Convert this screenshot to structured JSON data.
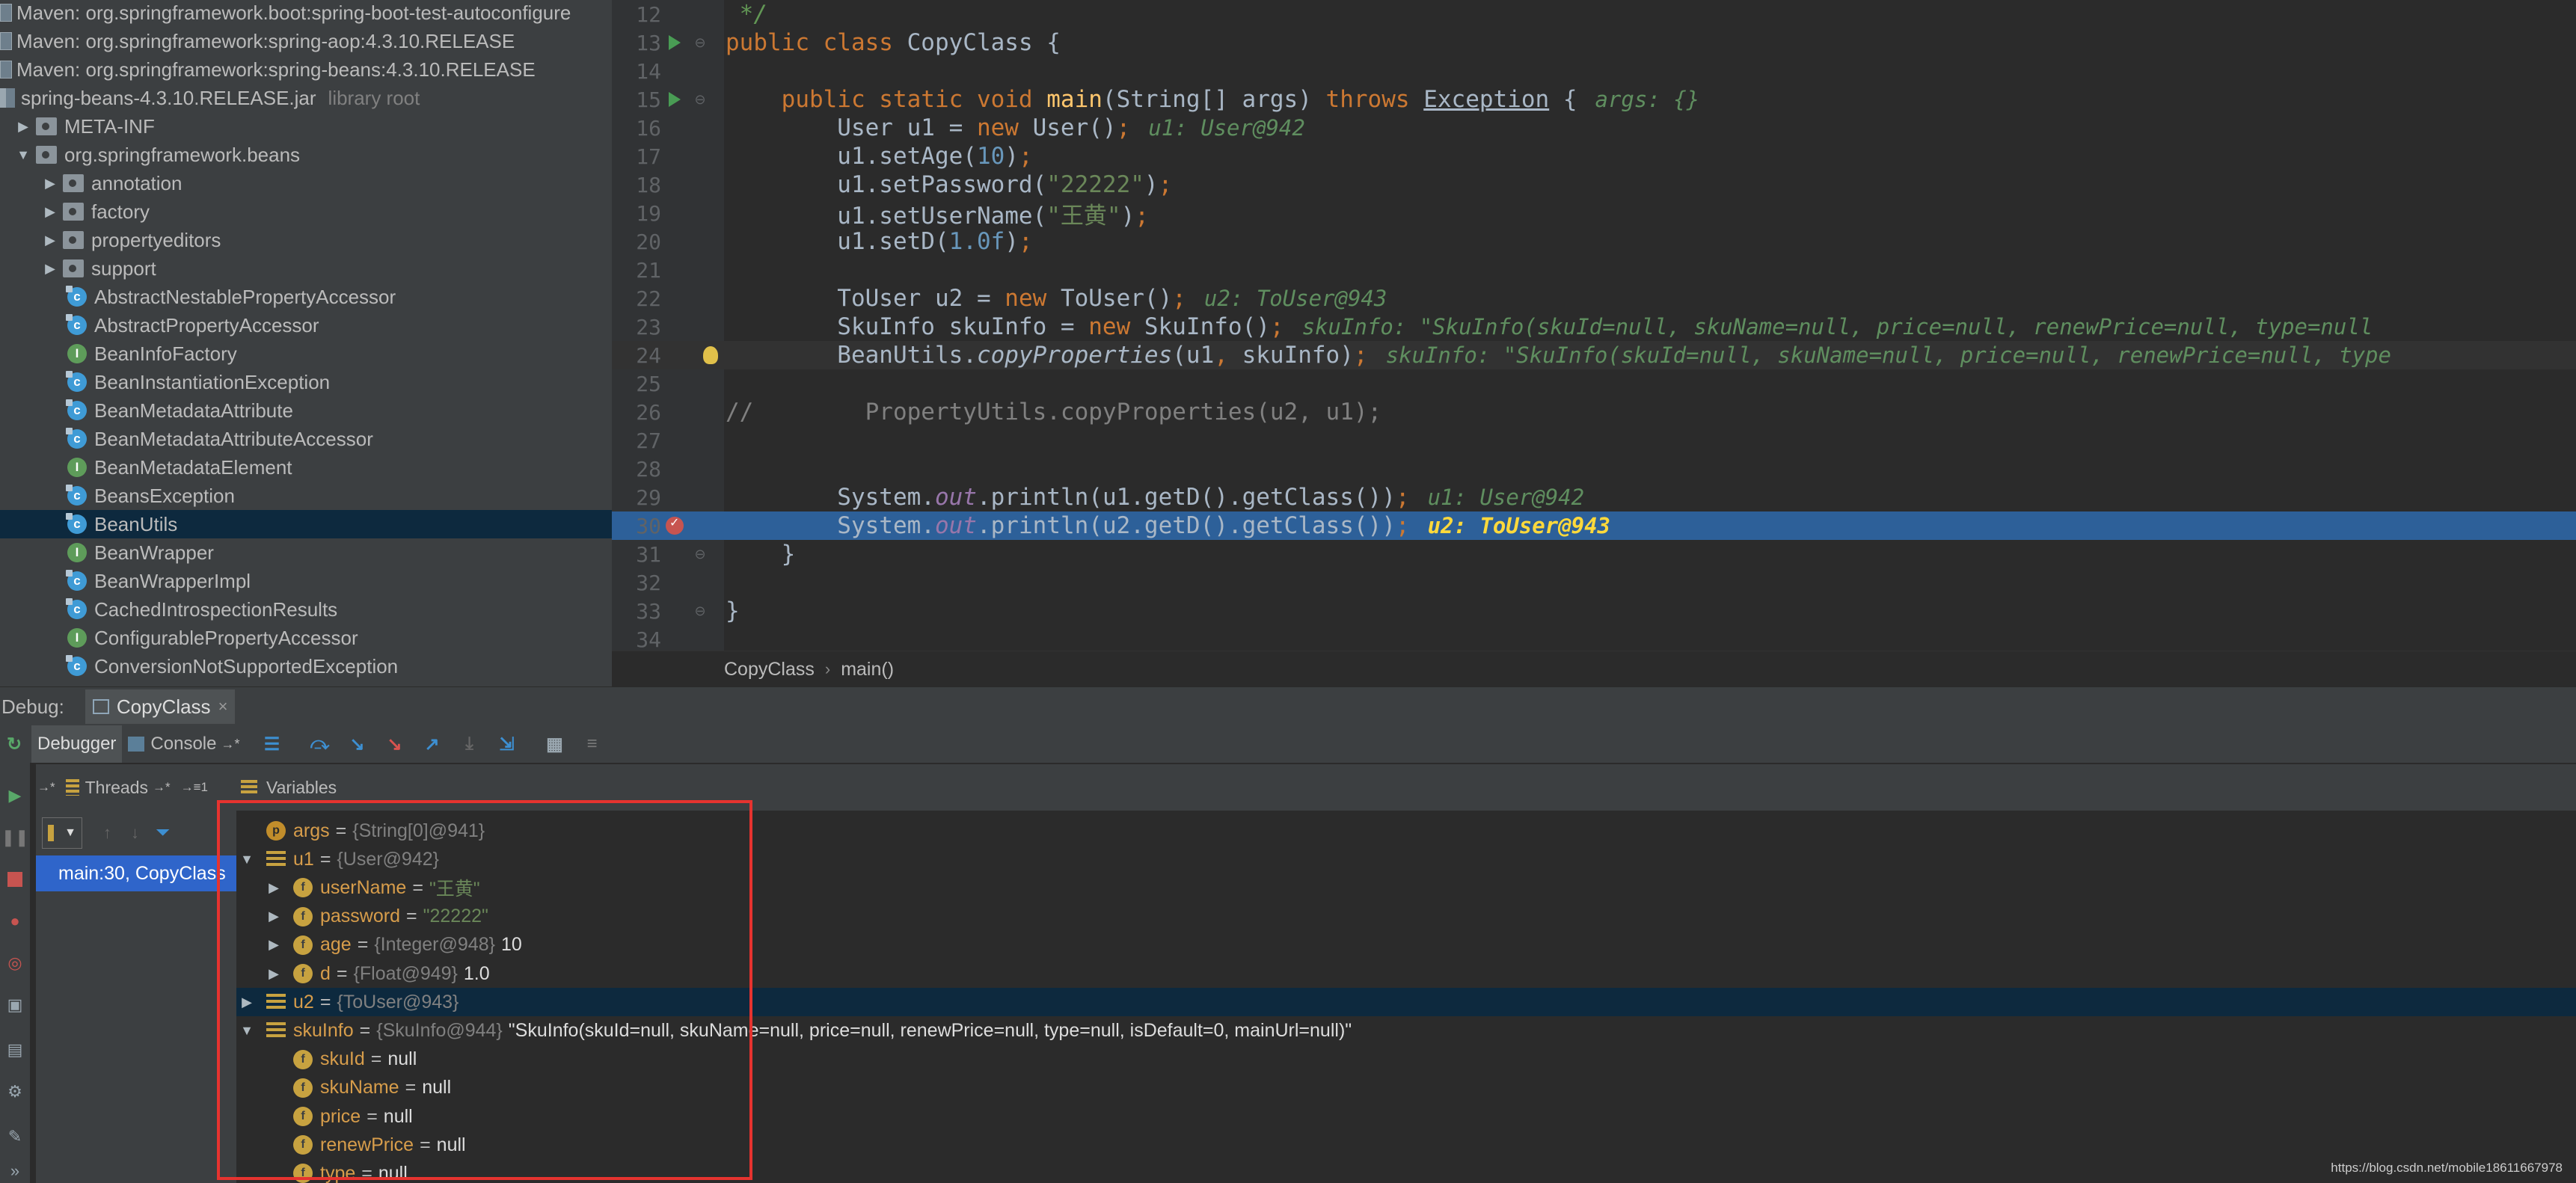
{
  "project_tree": {
    "rows": [
      {
        "icon": "maven-library-icon",
        "label": "Maven: org.springframework.boot:spring-boot-test-autoconfigure",
        "indent": 0,
        "toggle": "",
        "extra": ""
      },
      {
        "icon": "maven-library-icon",
        "label": "Maven: org.springframework:spring-aop:4.3.10.RELEASE",
        "indent": 0,
        "toggle": "",
        "extra": ""
      },
      {
        "icon": "maven-library-icon",
        "label": "Maven: org.springframework:spring-beans:4.3.10.RELEASE",
        "indent": 0,
        "toggle": "",
        "extra": ""
      },
      {
        "icon": "jar-icon",
        "label": "spring-beans-4.3.10.RELEASE.jar",
        "indent": 0,
        "toggle": "",
        "extra": "library root"
      },
      {
        "icon": "folder-icon",
        "label": "META-INF",
        "indent": 1,
        "toggle": "▶",
        "extra": ""
      },
      {
        "icon": "package-icon",
        "label": "org.springframework.beans",
        "indent": 1,
        "toggle": "▼",
        "extra": ""
      },
      {
        "icon": "package-icon",
        "label": "annotation",
        "indent": 2,
        "toggle": "▶",
        "extra": ""
      },
      {
        "icon": "package-icon",
        "label": "factory",
        "indent": 2,
        "toggle": "▶",
        "extra": ""
      },
      {
        "icon": "package-icon",
        "label": "propertyeditors",
        "indent": 2,
        "toggle": "▶",
        "extra": ""
      },
      {
        "icon": "package-icon",
        "label": "support",
        "indent": 2,
        "toggle": "▶",
        "extra": ""
      },
      {
        "icon": "class-icon",
        "label": "AbstractNestablePropertyAccessor",
        "indent": 3,
        "toggle": "",
        "extra": ""
      },
      {
        "icon": "class-icon",
        "label": "AbstractPropertyAccessor",
        "indent": 3,
        "toggle": "",
        "extra": ""
      },
      {
        "icon": "interface-icon",
        "label": "BeanInfoFactory",
        "indent": 3,
        "toggle": "",
        "extra": ""
      },
      {
        "icon": "class-icon",
        "label": "BeanInstantiationException",
        "indent": 3,
        "toggle": "",
        "extra": ""
      },
      {
        "icon": "class-icon",
        "label": "BeanMetadataAttribute",
        "indent": 3,
        "toggle": "",
        "extra": ""
      },
      {
        "icon": "class-icon",
        "label": "BeanMetadataAttributeAccessor",
        "indent": 3,
        "toggle": "",
        "extra": ""
      },
      {
        "icon": "interface-icon",
        "label": "BeanMetadataElement",
        "indent": 3,
        "toggle": "",
        "extra": ""
      },
      {
        "icon": "class-icon",
        "label": "BeansException",
        "indent": 3,
        "toggle": "",
        "extra": ""
      },
      {
        "icon": "class-icon",
        "label": "BeanUtils",
        "indent": 3,
        "toggle": "",
        "extra": "",
        "selected": true
      },
      {
        "icon": "interface-icon",
        "label": "BeanWrapper",
        "indent": 3,
        "toggle": "",
        "extra": ""
      },
      {
        "icon": "class-icon",
        "label": "BeanWrapperImpl",
        "indent": 3,
        "toggle": "",
        "extra": ""
      },
      {
        "icon": "class-icon",
        "label": "CachedIntrospectionResults",
        "indent": 3,
        "toggle": "",
        "extra": ""
      },
      {
        "icon": "interface-icon",
        "label": "ConfigurablePropertyAccessor",
        "indent": 3,
        "toggle": "",
        "extra": ""
      },
      {
        "icon": "class-icon",
        "label": "ConversionNotSupportedException",
        "indent": 3,
        "toggle": "",
        "extra": ""
      }
    ]
  },
  "editor": {
    "lines": [
      {
        "n": "12",
        "mark": "",
        "fold": "",
        "html": "<span class=\"cmd\"> */</span>",
        "inlay": ""
      },
      {
        "n": "13",
        "mark": "run",
        "fold": "⊖",
        "html": "<span class=\"kw\">public class </span>CopyClass {",
        "inlay": ""
      },
      {
        "n": "14",
        "mark": "",
        "fold": "",
        "html": "",
        "inlay": ""
      },
      {
        "n": "15",
        "mark": "run",
        "fold": "⊖",
        "html": "    <span class=\"kw\">public static void </span><span class=\"fn\">main</span>(String[] args) <span class=\"kw\">throws </span><span class=\"ul\">Exception</span> {",
        "inlay": "args: {}"
      },
      {
        "n": "16",
        "mark": "",
        "fold": "",
        "html": "        User u1 = <span class=\"kw\">new </span>User()<span class=\"kw\">;</span>",
        "inlay": "u1: User@942"
      },
      {
        "n": "17",
        "mark": "",
        "fold": "",
        "html": "        u1.setAge(<span class=\"num\">10</span>)<span class=\"kw\">;</span>",
        "inlay": ""
      },
      {
        "n": "18",
        "mark": "",
        "fold": "",
        "html": "        u1.setPassword(<span class=\"str\">\"22222\"</span>)<span class=\"kw\">;</span>",
        "inlay": ""
      },
      {
        "n": "19",
        "mark": "",
        "fold": "",
        "html": "        u1.setUserName(<span class=\"str\">\"王黄\"</span>)<span class=\"kw\">;</span>",
        "inlay": ""
      },
      {
        "n": "20",
        "mark": "",
        "fold": "",
        "html": "        u1.setD(<span class=\"num\">1.0f</span>)<span class=\"kw\">;</span>",
        "inlay": ""
      },
      {
        "n": "21",
        "mark": "",
        "fold": "",
        "html": "",
        "inlay": ""
      },
      {
        "n": "22",
        "mark": "",
        "fold": "",
        "html": "        ToUser u2 = <span class=\"kw\">new </span>ToUser()<span class=\"kw\">;</span>",
        "inlay": "u2: ToUser@943"
      },
      {
        "n": "23",
        "mark": "",
        "fold": "",
        "html": "        SkuInfo skuInfo = <span class=\"kw\">new </span>SkuInfo()<span class=\"kw\">;</span>",
        "inlay": "skuInfo: \"SkuInfo(skuId=null, skuName=null, price=null, renewPrice=null, type=null"
      },
      {
        "n": "24",
        "mark": "bulb",
        "fold": "",
        "html": "        BeanUtils.<span class=\"it\">copyProperties</span>(u1<span class=\"kw\">, </span>skuInfo)<span class=\"kw\">;</span>",
        "inlay": "skuInfo: \"SkuInfo(skuId=null, skuName=null, price=null, renewPrice=null, type",
        "cur": true
      },
      {
        "n": "25",
        "mark": "",
        "fold": "",
        "html": "",
        "inlay": ""
      },
      {
        "n": "26",
        "mark": "",
        "fold": "",
        "html": "<span class=\"cm\">//        PropertyUtils.copyProperties(u2, u1);</span>",
        "inlay": ""
      },
      {
        "n": "27",
        "mark": "",
        "fold": "",
        "html": "",
        "inlay": ""
      },
      {
        "n": "28",
        "mark": "",
        "fold": "",
        "html": "",
        "inlay": ""
      },
      {
        "n": "29",
        "mark": "",
        "fold": "",
        "html": "        System.<span class=\"st\">out</span>.println(u1.getD().getClass())<span class=\"kw\">;</span>",
        "inlay": "u1: User@942"
      },
      {
        "n": "30",
        "mark": "bp",
        "fold": "",
        "html": "        System.<span class=\"st\">out</span>.println(u2.getD().getClass())<span class=\"kw\">;</span>",
        "inlay": "u2: ToUser@943",
        "hl": true
      },
      {
        "n": "31",
        "mark": "",
        "fold": "⊖",
        "html": "    }",
        "inlay": ""
      },
      {
        "n": "32",
        "mark": "",
        "fold": "",
        "html": "",
        "inlay": ""
      },
      {
        "n": "33",
        "mark": "",
        "fold": "⊖",
        "html": "}",
        "inlay": ""
      },
      {
        "n": "34",
        "mark": "",
        "fold": "",
        "html": "",
        "inlay": ""
      }
    ],
    "breadcrumb": [
      "CopyClass",
      "main()"
    ]
  },
  "debug": {
    "label": "Debug:",
    "session_tab": "CopyClass",
    "tabs": {
      "debugger": "Debugger",
      "console": "Console"
    },
    "threads_label": "Threads",
    "variables_label": "Variables",
    "frame": "main:30, CopyClass",
    "variables": [
      {
        "depth": 0,
        "toggle": "",
        "icon": "p",
        "name": "args",
        "type": "{String[0]@941}",
        "value": "",
        "str": false
      },
      {
        "depth": 0,
        "toggle": "▼",
        "icon": "l",
        "name": "u1",
        "type": "{User@942}",
        "value": "",
        "str": false
      },
      {
        "depth": 1,
        "toggle": "▶",
        "icon": "f",
        "name": "userName",
        "type": "",
        "value": "\"王黄\"",
        "str": true
      },
      {
        "depth": 1,
        "toggle": "▶",
        "icon": "f",
        "name": "password",
        "type": "",
        "value": "\"22222\"",
        "str": true
      },
      {
        "depth": 1,
        "toggle": "▶",
        "icon": "f",
        "name": "age",
        "type": "{Integer@948}",
        "value": "10",
        "str": false
      },
      {
        "depth": 1,
        "toggle": "▶",
        "icon": "f",
        "name": "d",
        "type": "{Float@949}",
        "value": "1.0",
        "str": false
      },
      {
        "depth": 0,
        "toggle": "▶",
        "icon": "l",
        "name": "u2",
        "type": "{ToUser@943}",
        "value": "",
        "str": false,
        "sel": true
      },
      {
        "depth": 0,
        "toggle": "▼",
        "icon": "l",
        "name": "skuInfo",
        "type": "{SkuInfo@944}",
        "value": "\"SkuInfo(skuId=null, skuName=null, price=null, renewPrice=null, type=null, isDefault=0, mainUrl=null)\"",
        "str": false
      },
      {
        "depth": 1,
        "toggle": "",
        "icon": "f",
        "name": "skuId",
        "type": "",
        "value": "null",
        "str": false
      },
      {
        "depth": 1,
        "toggle": "",
        "icon": "f",
        "name": "skuName",
        "type": "",
        "value": "null",
        "str": false
      },
      {
        "depth": 1,
        "toggle": "",
        "icon": "f",
        "name": "price",
        "type": "",
        "value": "null",
        "str": false
      },
      {
        "depth": 1,
        "toggle": "",
        "icon": "f",
        "name": "renewPrice",
        "type": "",
        "value": "null",
        "str": false
      },
      {
        "depth": 1,
        "toggle": "",
        "icon": "f",
        "name": "type",
        "type": "",
        "value": "null",
        "str": false
      }
    ]
  },
  "watermark": "https://blog.csdn.net/mobile18611667978",
  "colors": {
    "annotation": "#e6332f",
    "selection": "#2d6099",
    "frame_selected": "#2f65ca"
  }
}
